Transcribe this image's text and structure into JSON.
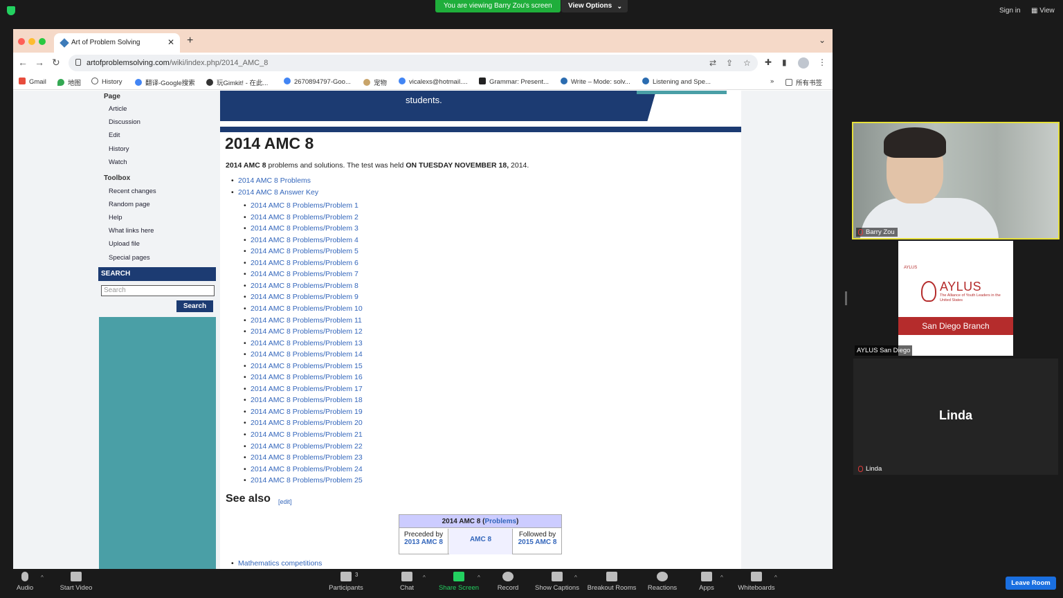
{
  "zoom": {
    "viewing_banner": "You are viewing Barry Zou's screen",
    "view_options": "View Options",
    "sign_in": "Sign in",
    "view": "View",
    "leave_room": "Leave Room",
    "toolbar": {
      "audio": "Audio",
      "start_video": "Start Video",
      "participants": "Participants",
      "participants_count": "3",
      "chat": "Chat",
      "share_screen": "Share Screen",
      "record": "Record",
      "show_captions": "Show Captions",
      "breakout_rooms": "Breakout Rooms",
      "reactions": "Reactions",
      "apps": "Apps",
      "whiteboards": "Whiteboards"
    },
    "gallery": {
      "tile1_name": "Barry Zou",
      "tile2_name": "AYLUS San Diego",
      "tile3_name": "Linda",
      "tile3_big": "Linda",
      "aylus_small": "AYLUS",
      "aylus_word": "AYLUS",
      "aylus_sub": "The Alliance of Youth Leaders in the United States",
      "aylus_band": "San Diego Branch"
    }
  },
  "browser": {
    "tab_title": "Art of Problem Solving",
    "url_domain": "artofproblemsolving.com",
    "url_path": "/wiki/index.php/2014_AMC_8",
    "bookmarks": [
      "Gmail",
      "地图",
      "History",
      "翻译-Google搜索",
      "玩Gimkit! - 在此...",
      "2670894797-Goo...",
      "宠物",
      "vicalexs@hotmail....",
      "Grammar: Present...",
      "Write – Mode: solv...",
      "Listening and Spe..."
    ],
    "all_bookmarks": "所有书签",
    "more_chevron": "»"
  },
  "page": {
    "sidebar": {
      "page_heading": "Page",
      "page_links": [
        "Article",
        "Discussion",
        "Edit",
        "History",
        "Watch"
      ],
      "toolbox_heading": "Toolbox",
      "toolbox_links": [
        "Recent changes",
        "Random page",
        "Help",
        "What links here",
        "Upload file",
        "Special pages"
      ],
      "search_heading": "SEARCH",
      "search_placeholder": "Search",
      "search_button": "Search"
    },
    "banner_text": "students.",
    "title": "2014 AMC 8",
    "intro_bold": "2014 AMC 8",
    "intro_mid": " problems and solutions. The test was held ",
    "intro_date": "ON TUESDAY NOVEMBER 18,",
    "intro_end": " 2014.",
    "top_links": [
      "2014 AMC 8 Problems",
      "2014 AMC 8 Answer Key"
    ],
    "problems": [
      "2014 AMC 8 Problems/Problem 1",
      "2014 AMC 8 Problems/Problem 2",
      "2014 AMC 8 Problems/Problem 3",
      "2014 AMC 8 Problems/Problem 4",
      "2014 AMC 8 Problems/Problem 5",
      "2014 AMC 8 Problems/Problem 6",
      "2014 AMC 8 Problems/Problem 7",
      "2014 AMC 8 Problems/Problem 8",
      "2014 AMC 8 Problems/Problem 9",
      "2014 AMC 8 Problems/Problem 10",
      "2014 AMC 8 Problems/Problem 11",
      "2014 AMC 8 Problems/Problem 12",
      "2014 AMC 8 Problems/Problem 13",
      "2014 AMC 8 Problems/Problem 14",
      "2014 AMC 8 Problems/Problem 15",
      "2014 AMC 8 Problems/Problem 16",
      "2014 AMC 8 Problems/Problem 17",
      "2014 AMC 8 Problems/Problem 18",
      "2014 AMC 8 Problems/Problem 19",
      "2014 AMC 8 Problems/Problem 20",
      "2014 AMC 8 Problems/Problem 21",
      "2014 AMC 8 Problems/Problem 22",
      "2014 AMC 8 Problems/Problem 23",
      "2014 AMC 8 Problems/Problem 24",
      "2014 AMC 8 Problems/Problem 25"
    ],
    "see_also": "See also",
    "edit": "[edit]",
    "navbox": {
      "title_prefix": "2014 AMC 8 (",
      "title_link": "Problems",
      "title_suffix": ")",
      "preceded_by": "Preceded by",
      "preceded_link": "2013 AMC 8",
      "middle": "AMC 8",
      "followed_by": "Followed by",
      "followed_link": "2015 AMC 8"
    },
    "bottom_link": "Mathematics competitions"
  }
}
